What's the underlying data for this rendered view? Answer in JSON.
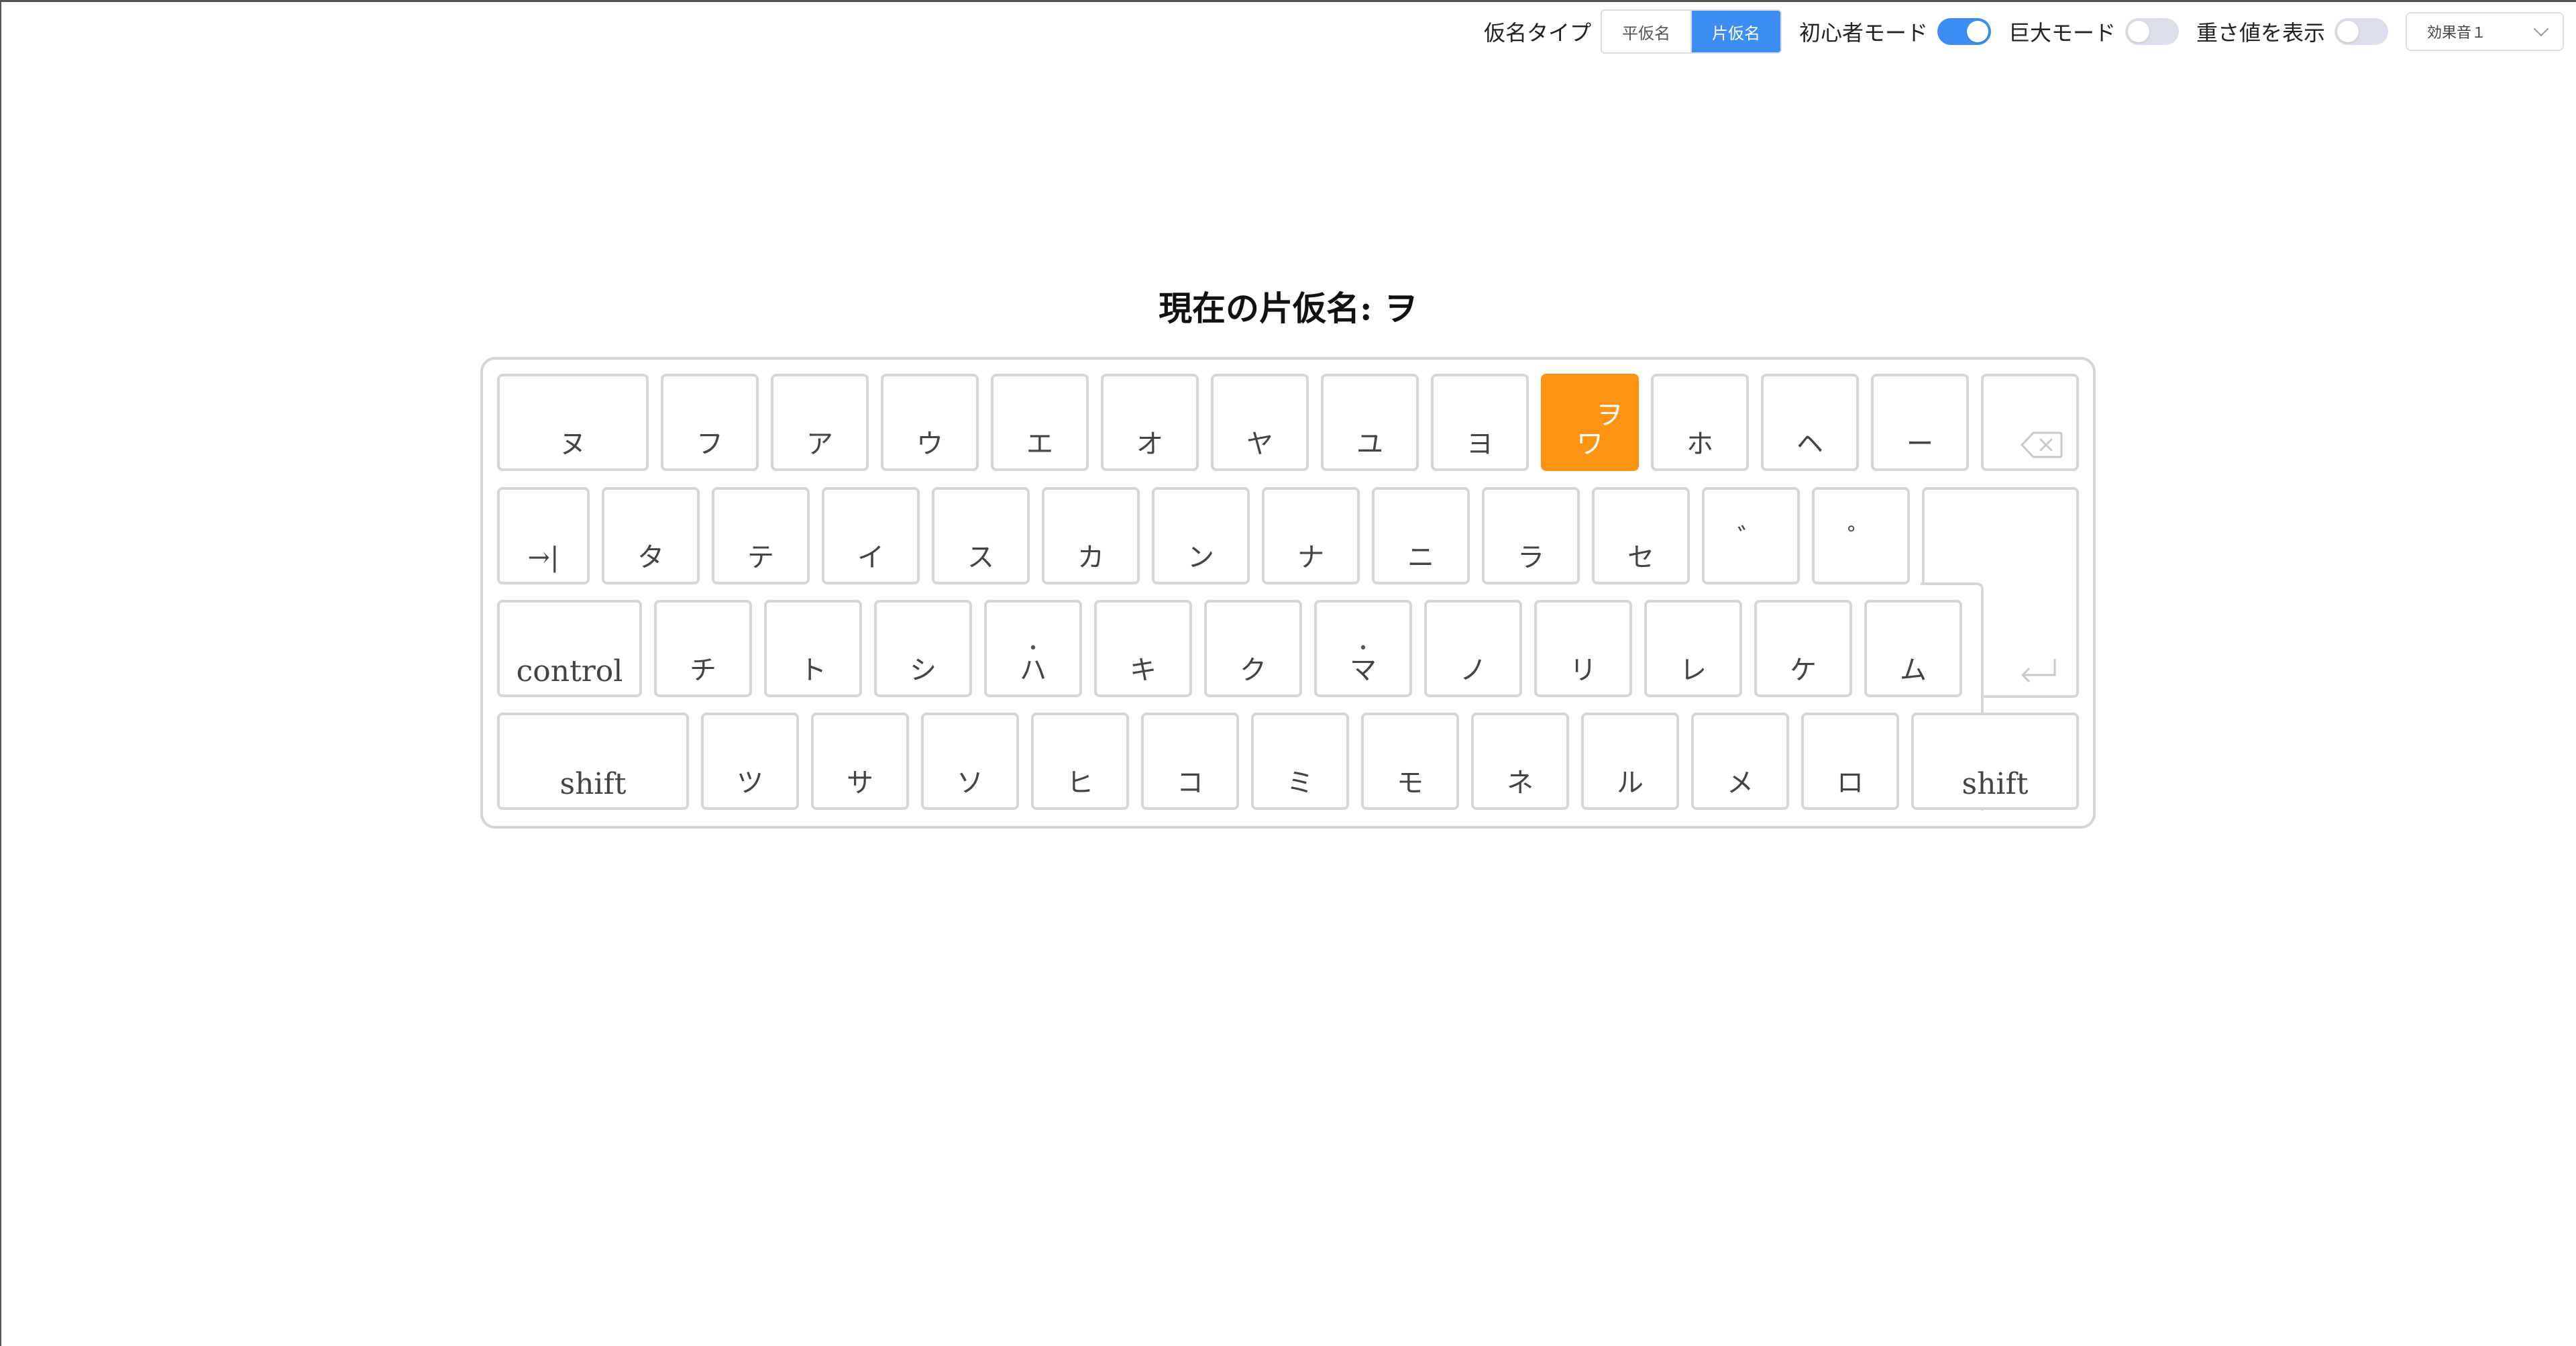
{
  "toolbar": {
    "kana_type_label": "仮名タイプ",
    "kana_options": [
      "平仮名",
      "片仮名"
    ],
    "selected_kana": "片仮名",
    "beginner_mode_label": "初心者モード",
    "beginner_mode_on": true,
    "huge_mode_label": "巨大モード",
    "huge_mode_on": false,
    "show_weight_label": "重さ値を表示",
    "show_weight_on": false,
    "sound_effect_value": "効果音１"
  },
  "title": "現在の片仮名: ヲ",
  "keyboard": {
    "highlight_color": "#ff9412",
    "row1": [
      "ヌ",
      "フ",
      "ア",
      "ウ",
      "エ",
      "オ",
      "ヤ",
      "ユ",
      "ヨ",
      "ワ",
      "ホ",
      "ヘ",
      "ー"
    ],
    "highlight_alt": "ヲ",
    "row2": [
      "→|",
      "タ",
      "テ",
      "イ",
      "ス",
      "カ",
      "ン",
      "ナ",
      "ニ",
      "ラ",
      "セ",
      "゛",
      "゜"
    ],
    "row3": [
      "control",
      "チ",
      "ト",
      "シ",
      "ハ",
      "キ",
      "ク",
      "マ",
      "ノ",
      "リ",
      "レ",
      "ケ",
      "ム"
    ],
    "row4": [
      "shift",
      "ツ",
      "サ",
      "ソ",
      "ヒ",
      "コ",
      "ミ",
      "モ",
      "ネ",
      "ル",
      "メ",
      "ロ",
      "shift"
    ]
  },
  "icons": {
    "backspace": "backspace-icon",
    "enter": "return-icon"
  }
}
